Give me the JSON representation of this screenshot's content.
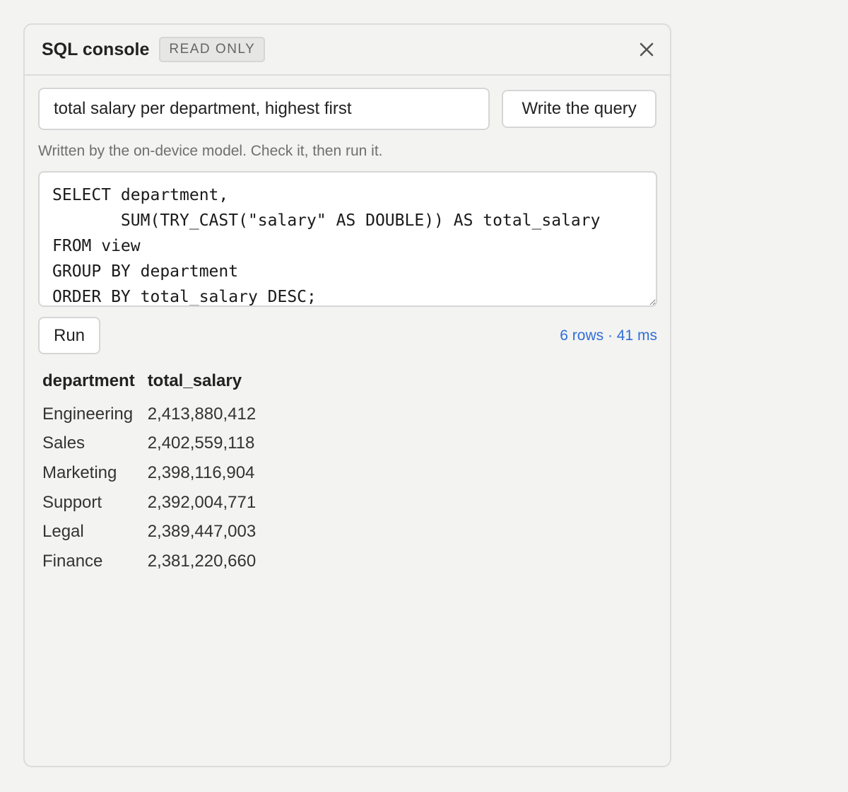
{
  "header": {
    "title": "SQL console",
    "badge": "READ ONLY"
  },
  "prompt": {
    "value": "total salary per department, highest first",
    "write_label": "Write the query"
  },
  "hint": "Written by the on-device model. Check it, then run it.",
  "editor": {
    "sql": "SELECT department,\n       SUM(TRY_CAST(\"salary\" AS DOUBLE)) AS total_salary\nFROM view\nGROUP BY department\nORDER BY total_salary DESC;"
  },
  "run": {
    "label": "Run",
    "status": "6 rows · 41 ms"
  },
  "results": {
    "columns": [
      "department",
      "total_salary"
    ],
    "rows": [
      [
        "Engineering",
        "2,413,880,412"
      ],
      [
        "Sales",
        "2,402,559,118"
      ],
      [
        "Marketing",
        "2,398,116,904"
      ],
      [
        "Support",
        "2,392,004,771"
      ],
      [
        "Legal",
        "2,389,447,003"
      ],
      [
        "Finance",
        "2,381,220,660"
      ]
    ]
  },
  "colors": {
    "status": "#2f6fd6",
    "background": "#f3f3f2"
  }
}
